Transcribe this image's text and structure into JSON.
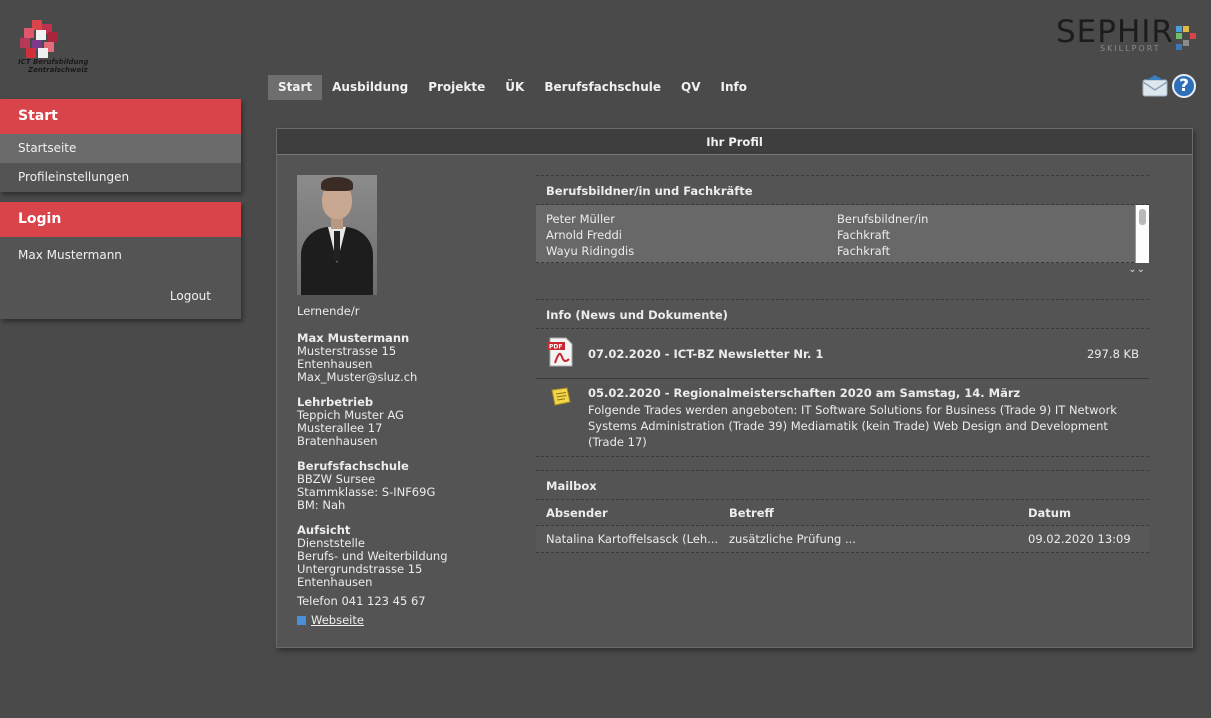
{
  "branding": {
    "ict_logo_line1": "ICT Berufsbildung",
    "ict_logo_line2": "Zentralschweiz",
    "sephir_word": "SEPHIR",
    "sephir_sub": "SKILLPORT"
  },
  "sidebar": {
    "start_header": "Start",
    "items": [
      {
        "label": "Startseite",
        "active": true
      },
      {
        "label": "Profileinstellungen",
        "active": false
      }
    ],
    "login_header": "Login",
    "user_name": "Max Mustermann",
    "logout_label": "Logout"
  },
  "topnav": {
    "items": [
      "Start",
      "Ausbildung",
      "Projekte",
      "ÜK",
      "Berufsfachschule",
      "QV",
      "Info"
    ],
    "active": "Start"
  },
  "icons": {
    "mail": "envelope-icon",
    "help": "help-icon",
    "help_glyph": "?"
  },
  "panel": {
    "title": "Ihr Profil"
  },
  "profile": {
    "role": "Lernende/r",
    "name": "Max Mustermann",
    "street": "Musterstrasse 15",
    "city": "Entenhausen",
    "email": "Max_Muster@sluz.ch",
    "lehrbetrieb_head": "Lehrbetrieb",
    "lehrbetrieb_name": "Teppich Muster AG",
    "lehrbetrieb_street": "Musterallee 17",
    "lehrbetrieb_city": "Bratenhausen",
    "schule_head": "Berufsfachschule",
    "schule_name": "BBZW Sursee",
    "schule_klasse": "Stammklasse: S-INF69G",
    "schule_bm": "BM: Nah",
    "aufsicht_head": "Aufsicht",
    "aufsicht_1": "Dienststelle",
    "aufsicht_2": "Berufs- und Weiterbildung",
    "aufsicht_3": "Untergrundstrasse 15",
    "aufsicht_4": "Entenhausen",
    "phone": "Telefon 041 123 45 67",
    "website_label": "Webseite"
  },
  "trainers": {
    "title": "Berufsbildner/in und Fachkräfte",
    "rows": [
      {
        "name": "Peter Müller",
        "role": "Berufsbildner/in"
      },
      {
        "name": "Arnold Freddi",
        "role": "Fachkraft"
      },
      {
        "name": "Wayu Ridingdis",
        "role": "Fachkraft"
      }
    ],
    "expand_glyph": "⌄⌄"
  },
  "info": {
    "title": "Info (News und Dokumente)",
    "news": [
      {
        "title": "07.02.2020 - ICT-BZ Newsletter Nr. 1",
        "size": "297.8 KB",
        "icon": "pdf-icon"
      },
      {
        "title": "05.02.2020 - Regionalmeisterschaften 2020 am Samstag, 14. März",
        "text": "Folgende Trades werden angeboten: IT Software Solutions for Business (Trade 9) IT Network Systems Administration (Trade 39) Mediamatik (kein Trade) Web Design and Development (Trade 17)",
        "icon": "note-icon"
      }
    ]
  },
  "mailbox": {
    "title": "Mailbox",
    "columns": [
      "Absender",
      "Betreff",
      "Datum"
    ],
    "rows": [
      {
        "sender": "Natalina Kartoffelsasck (Leh...",
        "subject": "zusätzliche Prüfung ...",
        "date": "09.02.2020 13:09"
      }
    ]
  },
  "colors": {
    "accent_red": "#d9434a",
    "background": "#4a4a4a",
    "panel": "#545454"
  }
}
